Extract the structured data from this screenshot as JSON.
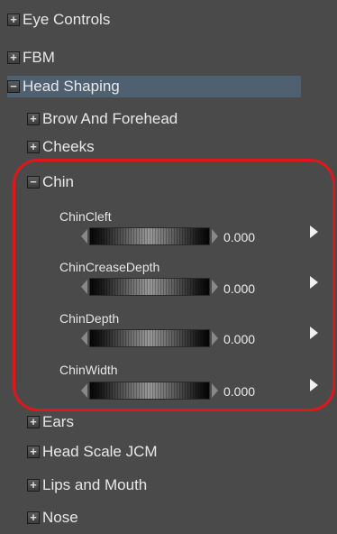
{
  "tree": {
    "eye_controls": "Eye Controls",
    "fbm": "FBM",
    "head_shaping": "Head Shaping",
    "brow_and_forehead": "Brow And Forehead",
    "cheeks": "Cheeks",
    "chin": "Chin",
    "ears": "Ears",
    "head_scale_jcm": "Head Scale JCM",
    "lips_and_mouth": "Lips and Mouth",
    "nose": "Nose"
  },
  "expanders": {
    "collapsed": "+",
    "expanded": "−"
  },
  "params": [
    {
      "name": "ChinCleft",
      "value": "0.000"
    },
    {
      "name": "ChinCreaseDepth",
      "value": "0.000"
    },
    {
      "name": "ChinDepth",
      "value": "0.000"
    },
    {
      "name": "ChinWidth",
      "value": "0.000"
    }
  ],
  "colors": {
    "selected_row": "#4f6070",
    "highlight_outline": "#e0161b",
    "background": "#4a4a4a"
  }
}
